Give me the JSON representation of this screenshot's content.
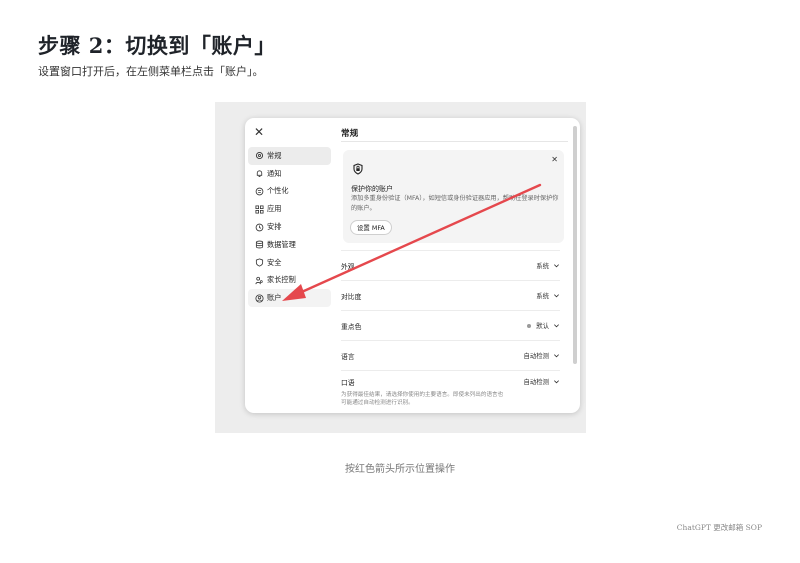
{
  "page": {
    "step_title": "步骤 2：切换到「账户」",
    "step_desc": "设置窗口打开后，在左侧菜单栏点击「账户」。",
    "caption": "按红色箭头所示位置操作",
    "footer": "ChatGPT 更改邮箱 SOP"
  },
  "dialog": {
    "close_icon": "close-icon",
    "nav": [
      {
        "label": "常规",
        "icon": "gear-icon"
      },
      {
        "label": "通知",
        "icon": "bell-icon"
      },
      {
        "label": "个性化",
        "icon": "personalize-icon"
      },
      {
        "label": "应用",
        "icon": "grid-icon"
      },
      {
        "label": "安排",
        "icon": "clock-icon"
      },
      {
        "label": "数据管理",
        "icon": "database-icon"
      },
      {
        "label": "安全",
        "icon": "shield-icon"
      },
      {
        "label": "家长控制",
        "icon": "family-icon"
      },
      {
        "label": "账户",
        "icon": "account-icon"
      }
    ],
    "main_title": "常规",
    "mfa": {
      "heading": "保护你的账户",
      "desc": "添加多重身份验证（MFA），如短信或身份验证器应用，帮助在登录时保护你的账户。",
      "button": "设置 MFA"
    },
    "settings": [
      {
        "label": "外观",
        "value": "系统"
      },
      {
        "label": "对比度",
        "value": "系统"
      },
      {
        "label": "重点色",
        "value": "默认"
      },
      {
        "label": "语言",
        "value": "自动检测"
      },
      {
        "label": "口语",
        "value": "自动检测"
      }
    ],
    "voice_note": "为获得最佳结果，请选择你使用的主要语言。即使未列出的语言也可能通过自动检测进行识别。"
  },
  "colors": {
    "arrow": "#e5484d",
    "text": "#1f2329"
  }
}
